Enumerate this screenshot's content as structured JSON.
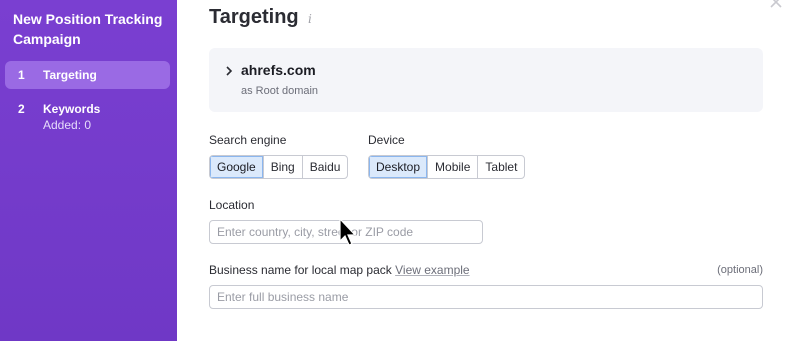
{
  "sidebar": {
    "title": "New Position Tracking Campaign",
    "steps": [
      {
        "number": "1",
        "label": "Targeting",
        "sublabel": ""
      },
      {
        "number": "2",
        "label": "Keywords",
        "sublabel": "Added: 0"
      }
    ]
  },
  "main": {
    "title": "Targeting",
    "info_glyph": "i",
    "domain": {
      "name": "ahrefs.com",
      "type": "as Root domain"
    },
    "search_engine": {
      "label": "Search engine",
      "options": [
        "Google",
        "Bing",
        "Baidu"
      ],
      "selected": "Google"
    },
    "device": {
      "label": "Device",
      "options": [
        "Desktop",
        "Mobile",
        "Tablet"
      ],
      "selected": "Desktop"
    },
    "location": {
      "label": "Location",
      "placeholder": "Enter country, city, street or ZIP code",
      "value": ""
    },
    "business": {
      "label": "Business name for local map pack",
      "link": "View example",
      "optional": "(optional)",
      "placeholder": "Enter full business name",
      "value": ""
    }
  },
  "colors": {
    "sidebar_bg": "#7a3fd1",
    "active_step_bg": "#9a6ae4",
    "selected_segment_bg": "#dbe9fb"
  }
}
